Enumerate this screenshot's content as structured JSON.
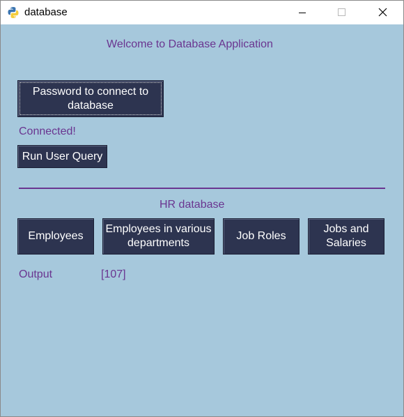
{
  "window": {
    "title": "database"
  },
  "main": {
    "welcome": "Welcome to Database Application",
    "password_button": "Password to connect to database",
    "status": "Connected!",
    "run_query_button": "Run User Query",
    "hr_section_label": "HR database",
    "hr_buttons": [
      {
        "label": "Employees"
      },
      {
        "label": "Employees in various departments"
      },
      {
        "label": "Job Roles"
      },
      {
        "label": "Jobs and Salaries"
      }
    ],
    "output_label": "Output",
    "output_value": "[107]"
  },
  "colors": {
    "background": "#a6c8dc",
    "button": "#2d3450",
    "accent_text": "#6a3590"
  },
  "icons": {
    "app": "python-logo-icon",
    "minimize": "minimize-icon",
    "maximize": "maximize-icon",
    "close": "close-icon"
  }
}
